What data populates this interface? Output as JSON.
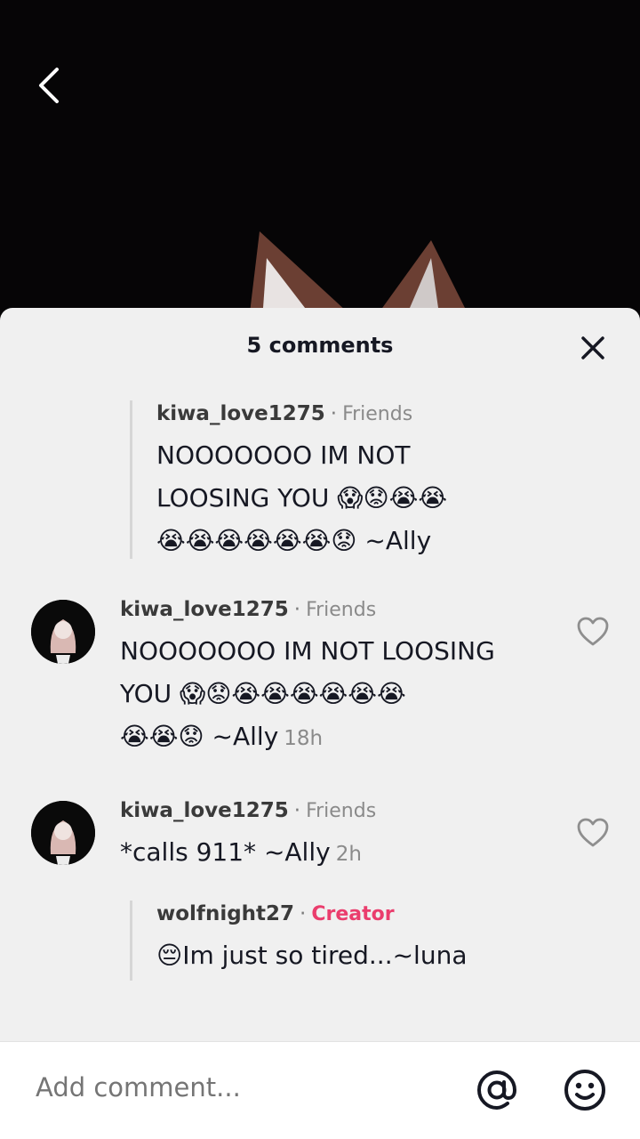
{
  "sheet": {
    "title": "5 comments"
  },
  "comments": [
    {
      "kind": "reply",
      "username": "kiwa_love1275",
      "tag": "Friends",
      "text": "NOOOOOOO IM NOT LOOSING YOU 😱😟😭😭😭😭😭😭😭😭😟 ~Ally",
      "line1": "NOOOOOOO IM NOT",
      "line2": "LOOSING YOU 😱😟😭😭",
      "line3": "😭😭😭😭😭😭😟 ~Ally"
    },
    {
      "kind": "comment",
      "username": "kiwa_love1275",
      "tag": "Friends",
      "line1": "NOOOOOOO IM NOT LOOSING",
      "line2": "YOU 😱😟😭😭😭😭😭😭",
      "line3": "😭😭😟 ~Ally",
      "time": "18h"
    },
    {
      "kind": "comment",
      "username": "kiwa_love1275",
      "tag": "Friends",
      "text": "*calls 911* ~Ally",
      "time": "2h"
    },
    {
      "kind": "reply",
      "username": "wolfnight27",
      "tag": "Creator",
      "text": "😔Im just so tired...~luna"
    }
  ],
  "separator": "·",
  "input": {
    "placeholder": "Add comment..."
  },
  "colors": {
    "creator_tag": "#ea3d6d",
    "sheet_bg": "#f0f0f0"
  },
  "icons": [
    "back-icon",
    "close-icon",
    "heart-icon",
    "at-icon",
    "emoji-icon"
  ]
}
